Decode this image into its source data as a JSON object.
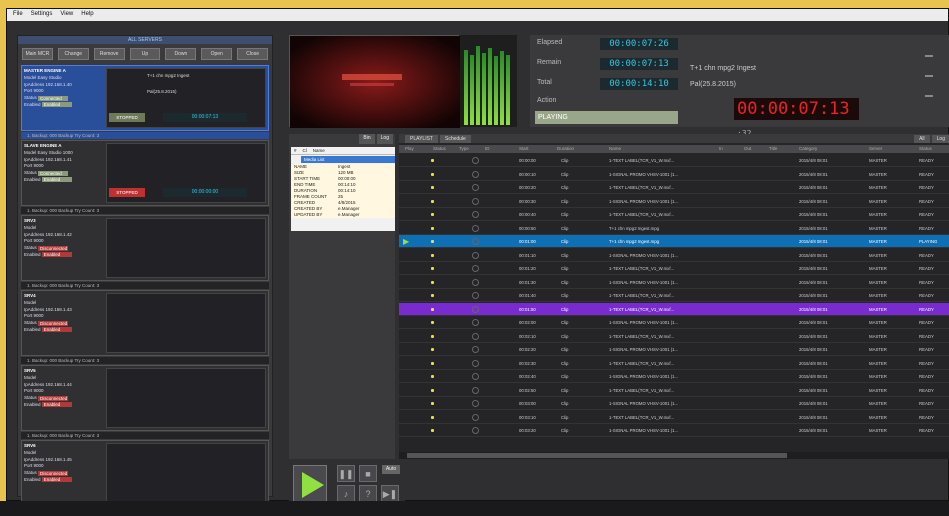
{
  "menu": [
    "File",
    "Settings",
    "View",
    "Help"
  ],
  "left_panel": {
    "header": "ALL SERVERS",
    "buttons": [
      "Main MCR",
      "Change",
      "Remove",
      "Up",
      "Down",
      "Open",
      "Close"
    ],
    "servers": [
      {
        "name": "MASTER",
        "channel": "ENGINE A",
        "model": "Easy Studio",
        "ip": "192.168.1.40",
        "port": "9000",
        "status": "Connected",
        "enabled": "Enabled",
        "detail_file": "T+1 chn mpg2 Ingest",
        "detail_fps": "Pal(25.8.2015)",
        "button": "STOPPED",
        "time": "00:00:07:13",
        "footer": "1. Backup: 000",
        "footer2": "Backup Try Count:",
        "footer_n": "3",
        "selected": true
      },
      {
        "name": "SLAVE",
        "channel": "ENGINE A",
        "model": "Easy Studio 1000",
        "ip": "192.168.1.41",
        "port": "9000",
        "status": "Connected",
        "enabled": "Enabled",
        "detail_file": "",
        "detail_fps": "",
        "button": "STOPPED",
        "time": "00:00:00:00",
        "footer": "1. Backup: 000",
        "footer2": "Backup Try Count:",
        "footer_n": "3",
        "selected": false
      },
      {
        "name": "SRV3",
        "channel": "",
        "model": "",
        "ip": "192.168.1.42",
        "port": "9000",
        "status": "Disconnected",
        "enabled": "Enabled",
        "footer": "1. Backup: 000",
        "footer2": "Backup Try Count:",
        "footer_n": "3",
        "selected": false
      },
      {
        "name": "SRV4",
        "channel": "",
        "model": "",
        "ip": "192.168.1.43",
        "port": "9000",
        "status": "Disconnected",
        "enabled": "Enabled",
        "footer": "1. Backup: 000",
        "footer2": "Backup Try Count:",
        "footer_n": "3",
        "selected": false
      },
      {
        "name": "SRV5",
        "channel": "",
        "model": "",
        "ip": "192.168.1.44",
        "port": "9000",
        "status": "Disconnected",
        "enabled": "Enabled",
        "footer": "1. Backup: 000",
        "footer2": "Backup Try Count:",
        "footer_n": "3",
        "selected": false
      },
      {
        "name": "SRV6",
        "channel": "",
        "model": "",
        "ip": "192.168.1.45",
        "port": "9000",
        "status": "Disconnected",
        "enabled": "Enabled",
        "footer": "1. Backup: 000",
        "footer2": "Backup Try Count:",
        "footer_n": "3",
        "selected": false
      }
    ],
    "field_labels": {
      "model": "Model",
      "ip": "IpAddress",
      "port": "Port",
      "status": "Status",
      "enabled": "Enabled"
    }
  },
  "times": {
    "elapsed_label": "Elapsed",
    "elapsed": "00:00:07:26",
    "remain_label": "Remain",
    "remain": "00:00:07:13",
    "total_label": "Total",
    "total": "00:00:14:10",
    "action_label": "Action",
    "action": "PLAYING",
    "clip_name": "T+1 chn mpg2 Ingest",
    "clip_fps": "Pal(25.8.2015)",
    "big_clock": "00:00:07:13",
    "big_clock_suffix": ":32"
  },
  "catalog": {
    "tabs": [
      "Bin",
      "Log"
    ],
    "columns": [
      "#",
      "Cl",
      "Name"
    ],
    "selected": "Media List",
    "props": [
      [
        "NAME",
        "Ingest"
      ],
      [
        "SIZE",
        "120 MB"
      ],
      [
        "START TIME",
        "00:00:00"
      ],
      [
        "END TIME",
        "00:14:10"
      ],
      [
        "DURATION",
        "00:14:10"
      ],
      [
        "FRAME COUNT",
        "25"
      ],
      [
        "CREATED",
        "4/8/2015"
      ],
      [
        "CREATED BY",
        "e.Manager"
      ],
      [
        "UPDATED BY",
        "e.Manager"
      ]
    ]
  },
  "playlist": {
    "tabs": [
      "PLAYLIST",
      "Schedule"
    ],
    "right_tabs": [
      "All",
      "Log"
    ],
    "columns": [
      "Play",
      "Status",
      "Type",
      "ID",
      "Start",
      "Duration",
      "Name",
      "In",
      "Out",
      "Title",
      "Category",
      "Server",
      "Status"
    ],
    "rows": [
      {
        "start": "00:00:00",
        "dur": "Clip",
        "name": "1-TEXT LABEL(TCR_V1_W.mxf...",
        "cat": "2015/4/8 08:01",
        "srv": "MASTER",
        "st": "READY"
      },
      {
        "start": "00:00:10",
        "dur": "Clip",
        "name": "1-SIGNAL PROMO VHSV-1001 (1...",
        "cat": "2015/4/8 08:01",
        "srv": "MASTER",
        "st": "READY"
      },
      {
        "start": "00:00:20",
        "dur": "Clip",
        "name": "1-TEXT LABEL(TCR_V1_W.mxf...",
        "cat": "2015/4/8 08:01",
        "srv": "MASTER",
        "st": "READY"
      },
      {
        "start": "00:00:30",
        "dur": "Clip",
        "name": "1-SIGNAL PROMO VHSV-1001 (1...",
        "cat": "2015/4/8 08:01",
        "srv": "MASTER",
        "st": "READY"
      },
      {
        "start": "00:00:40",
        "dur": "Clip",
        "name": "1-TEXT LABEL(TCR_V1_W.mxf...",
        "cat": "2015/4/8 08:01",
        "srv": "MASTER",
        "st": "READY"
      },
      {
        "start": "00:00:50",
        "dur": "Clip",
        "name": "T+1 chn mpg2 Ingest.mpg",
        "cat": "2015/4/8 08:01",
        "srv": "MASTER",
        "st": "READY"
      },
      {
        "start": "00:01:00",
        "dur": "Clip",
        "name": "T+1 chn mpg2 Ingest.mpg",
        "cat": "2015/4/8 08:01",
        "srv": "MASTER",
        "st": "PLAYING",
        "kind": "cur"
      },
      {
        "start": "00:01:10",
        "dur": "Clip",
        "name": "1-SIGNAL PROMO VHSV-1001 (1...",
        "cat": "2015/4/8 08:01",
        "srv": "MASTER",
        "st": "READY"
      },
      {
        "start": "00:01:20",
        "dur": "Clip",
        "name": "1-TEXT LABEL(TCR_V1_W.mxf...",
        "cat": "2015/4/8 08:01",
        "srv": "MASTER",
        "st": "READY"
      },
      {
        "start": "00:01:30",
        "dur": "Clip",
        "name": "1-SIGNAL PROMO VHSV-1001 (1...",
        "cat": "2015/4/8 08:01",
        "srv": "MASTER",
        "st": "READY"
      },
      {
        "start": "00:01:40",
        "dur": "Clip",
        "name": "1-TEXT LABEL(TCR_V1_W.mxf...",
        "cat": "2015/4/8 08:01",
        "srv": "MASTER",
        "st": "READY"
      },
      {
        "start": "00:01:50",
        "dur": "Clip",
        "name": "1-TEXT LABEL(TCR_V1_W.mxf...",
        "cat": "2015/4/8 08:01",
        "srv": "MASTER",
        "st": "READY",
        "kind": "violet"
      },
      {
        "start": "00:02:00",
        "dur": "Clip",
        "name": "1-SIGNAL PROMO VHSV-1001 (1...",
        "cat": "2015/4/8 08:01",
        "srv": "MASTER",
        "st": "READY"
      },
      {
        "start": "00:02:10",
        "dur": "Clip",
        "name": "1-TEXT LABEL(TCR_V1_W.mxf...",
        "cat": "2015/4/8 08:01",
        "srv": "MASTER",
        "st": "READY"
      },
      {
        "start": "00:02:20",
        "dur": "Clip",
        "name": "1-SIGNAL PROMO VHSV-1001 (1...",
        "cat": "2015/4/8 08:01",
        "srv": "MASTER",
        "st": "READY"
      },
      {
        "start": "00:02:30",
        "dur": "Clip",
        "name": "1-TEXT LABEL(TCR_V1_W.mxf...",
        "cat": "2015/4/8 08:01",
        "srv": "MASTER",
        "st": "READY"
      },
      {
        "start": "00:02:40",
        "dur": "Clip",
        "name": "1-SIGNAL PROMO VHSV-1001 (1...",
        "cat": "2015/4/8 08:01",
        "srv": "MASTER",
        "st": "READY"
      },
      {
        "start": "00:02:50",
        "dur": "Clip",
        "name": "1-TEXT LABEL(TCR_V1_W.mxf...",
        "cat": "2015/4/8 08:01",
        "srv": "MASTER",
        "st": "READY"
      },
      {
        "start": "00:03:00",
        "dur": "Clip",
        "name": "1-SIGNAL PROMO VHSV-1001 (1...",
        "cat": "2015/4/8 08:01",
        "srv": "MASTER",
        "st": "READY"
      },
      {
        "start": "00:03:10",
        "dur": "Clip",
        "name": "1-TEXT LABEL(TCR_V1_W.mxf...",
        "cat": "2015/4/8 08:01",
        "srv": "MASTER",
        "st": "READY"
      },
      {
        "start": "00:03:20",
        "dur": "Clip",
        "name": "1-SIGNAL PROMO VHSV-1001 (1...",
        "cat": "2015/4/8 08:01",
        "srv": "MASTER",
        "st": "READY"
      }
    ]
  },
  "transport": {
    "mode_label": "Auto"
  },
  "colors": {
    "accent": "#2a4f9a",
    "cur_row": "#0f6fb5",
    "violet_row": "#7a2bd0",
    "clock": "#e22222",
    "time_text": "#34c6e0",
    "play": "#8fe040"
  }
}
